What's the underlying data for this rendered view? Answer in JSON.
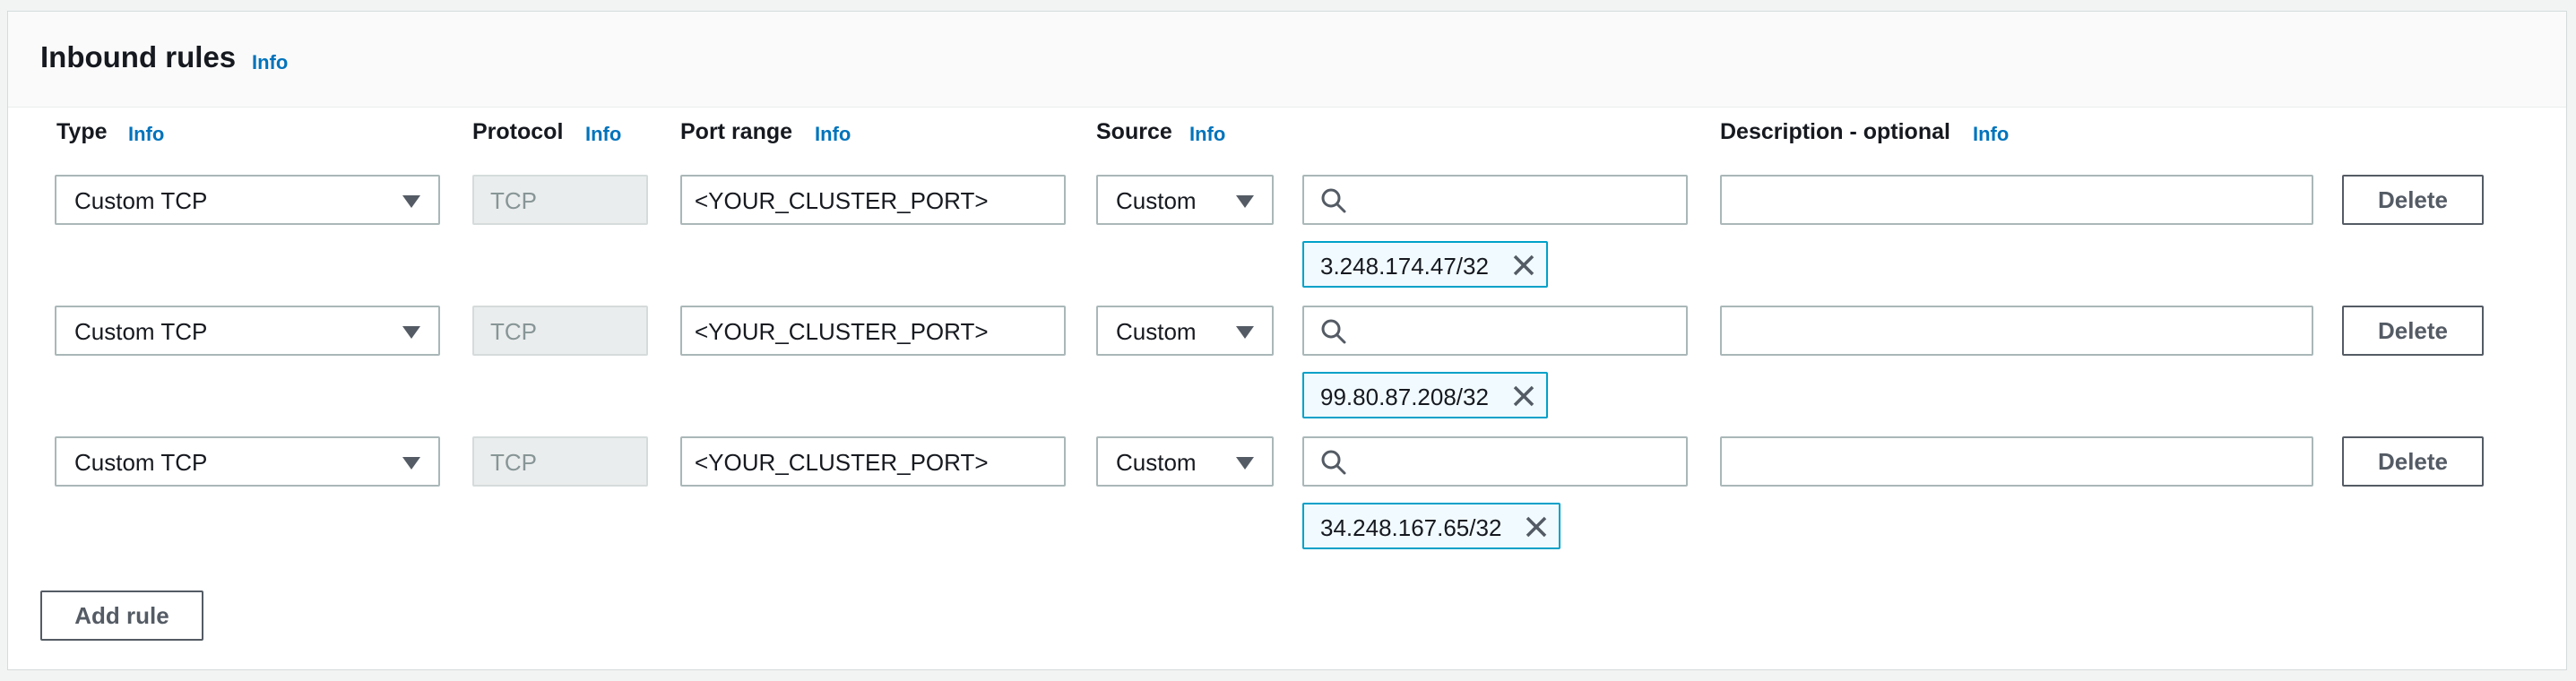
{
  "section": {
    "title": "Inbound rules",
    "info": "Info"
  },
  "columns": {
    "type": "Type",
    "protocol": "Protocol",
    "port_range": "Port range",
    "source": "Source",
    "description": "Description - optional",
    "info": "Info"
  },
  "rules": [
    {
      "type": "Custom TCP",
      "protocol": "TCP",
      "port": "<YOUR_CLUSTER_PORT>",
      "source": "Custom",
      "search_value": "",
      "cidr": "3.248.174.47/32",
      "description": "",
      "delete_label": "Delete"
    },
    {
      "type": "Custom TCP",
      "protocol": "TCP",
      "port": "<YOUR_CLUSTER_PORT>",
      "source": "Custom",
      "search_value": "",
      "cidr": "99.80.87.208/32",
      "description": "",
      "delete_label": "Delete"
    },
    {
      "type": "Custom TCP",
      "protocol": "TCP",
      "port": "<YOUR_CLUSTER_PORT>",
      "source": "Custom",
      "search_value": "",
      "cidr": "34.248.167.65/32",
      "description": "",
      "delete_label": "Delete"
    }
  ],
  "add_rule_label": "Add rule",
  "colors": {
    "link": "#0073bb",
    "token_border": "#00a1c9",
    "token_bg": "#f1faff"
  },
  "icons": {
    "search": "search-icon",
    "remove": "close-icon",
    "dropdown": "caret-down-icon"
  }
}
